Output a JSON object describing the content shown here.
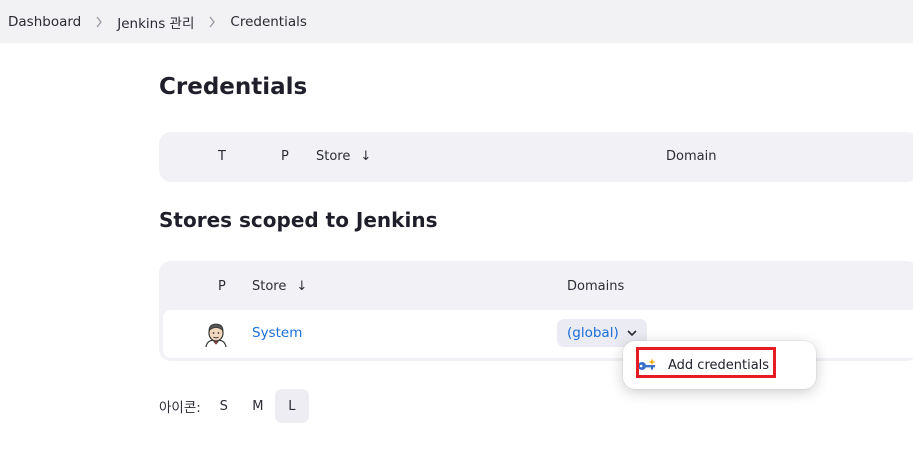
{
  "breadcrumb": [
    "Dashboard",
    "Jenkins 관리",
    "Credentials"
  ],
  "page_title": "Credentials",
  "credentials_table": {
    "headers": {
      "type": "T",
      "provider": "P",
      "store": "Store",
      "sort_indicator": "↓",
      "domain": "Domain"
    }
  },
  "stores_section_title": "Stores scoped to Jenkins",
  "stores_table": {
    "headers": {
      "provider": "P",
      "store": "Store",
      "sort_indicator": "↓",
      "domains": "Domains"
    },
    "rows": [
      {
        "icon": "jenkins-butler-icon",
        "store": "System",
        "domain": "(global)"
      }
    ]
  },
  "dropdown": {
    "items": [
      {
        "icon": "key-add-icon",
        "label": "Add credentials"
      }
    ]
  },
  "icon_size": {
    "label": "아이콘:",
    "options": [
      "S",
      "M",
      "L"
    ],
    "selected": "L"
  },
  "colors": {
    "link": "#1a6fd8",
    "highlight_border": "#e61b23",
    "table_bg": "#f2f2f6",
    "breadcrumb_bg": "#f2f2f5"
  }
}
